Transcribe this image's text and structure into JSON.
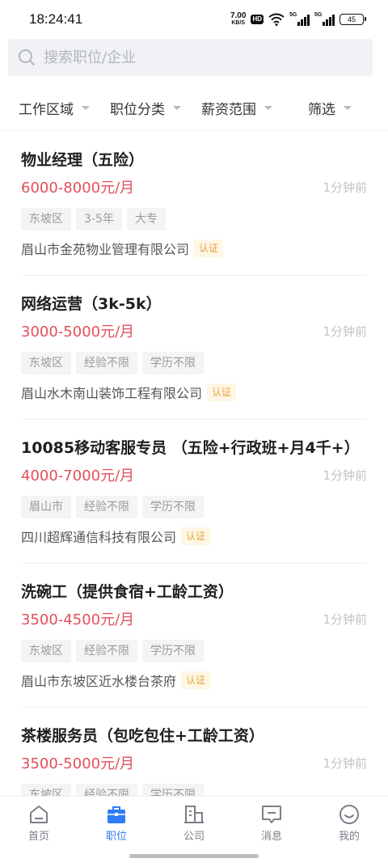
{
  "status_bar": {
    "time": "18:24:41",
    "net_speed_value": "7.00",
    "net_speed_unit": "KB/S",
    "hd": "HD",
    "signal_1_label": "5G",
    "signal_2_label": "5G",
    "battery": "45"
  },
  "search": {
    "placeholder": "搜索职位/企业"
  },
  "filters": [
    {
      "label": "工作区域"
    },
    {
      "label": "职位分类"
    },
    {
      "label": "薪资范围"
    },
    {
      "label": "筛选"
    }
  ],
  "jobs": [
    {
      "title": "物业经理（五险）",
      "salary": "6000-8000元/月",
      "time": "1分钟前",
      "tags": [
        "东坡区",
        "3-5年",
        "大专"
      ],
      "company": "眉山市金苑物业管理有限公司",
      "badge": "认证"
    },
    {
      "title": "网络运营（3k-5k）",
      "salary": "3000-5000元/月",
      "time": "1分钟前",
      "tags": [
        "东坡区",
        "经验不限",
        "学历不限"
      ],
      "company": "眉山水木南山装饰工程有限公司",
      "badge": "认证"
    },
    {
      "title": "10085移动客服专员 （五险+行政班+月4千+）",
      "salary": "4000-7000元/月",
      "time": "1分钟前",
      "tags": [
        "眉山市",
        "经验不限",
        "学历不限"
      ],
      "company": "四川超辉通信科技有限公司",
      "badge": "认证"
    },
    {
      "title": "洗碗工（提供食宿+工龄工资）",
      "salary": "3500-4500元/月",
      "time": "1分钟前",
      "tags": [
        "东坡区",
        "经验不限",
        "学历不限"
      ],
      "company": "眉山市东坡区近水楼台茶府",
      "badge": "认证"
    },
    {
      "title": "茶楼服务员（包吃包住+工龄工资）",
      "salary": "3500-5000元/月",
      "time": "1分钟前",
      "tags": [
        "东坡区",
        "经验不限",
        "学历不限"
      ],
      "company": "",
      "badge": ""
    }
  ],
  "tabs": [
    {
      "label": "首页",
      "icon": "home-icon"
    },
    {
      "label": "职位",
      "icon": "briefcase-icon"
    },
    {
      "label": "公司",
      "icon": "building-icon"
    },
    {
      "label": "消息",
      "icon": "message-icon"
    },
    {
      "label": "我的",
      "icon": "smiley-icon"
    }
  ],
  "colors": {
    "accent": "#2e7cf6",
    "salary": "#e0505a",
    "badge_text": "#e6a23c",
    "badge_bg": "#fff6e5"
  }
}
